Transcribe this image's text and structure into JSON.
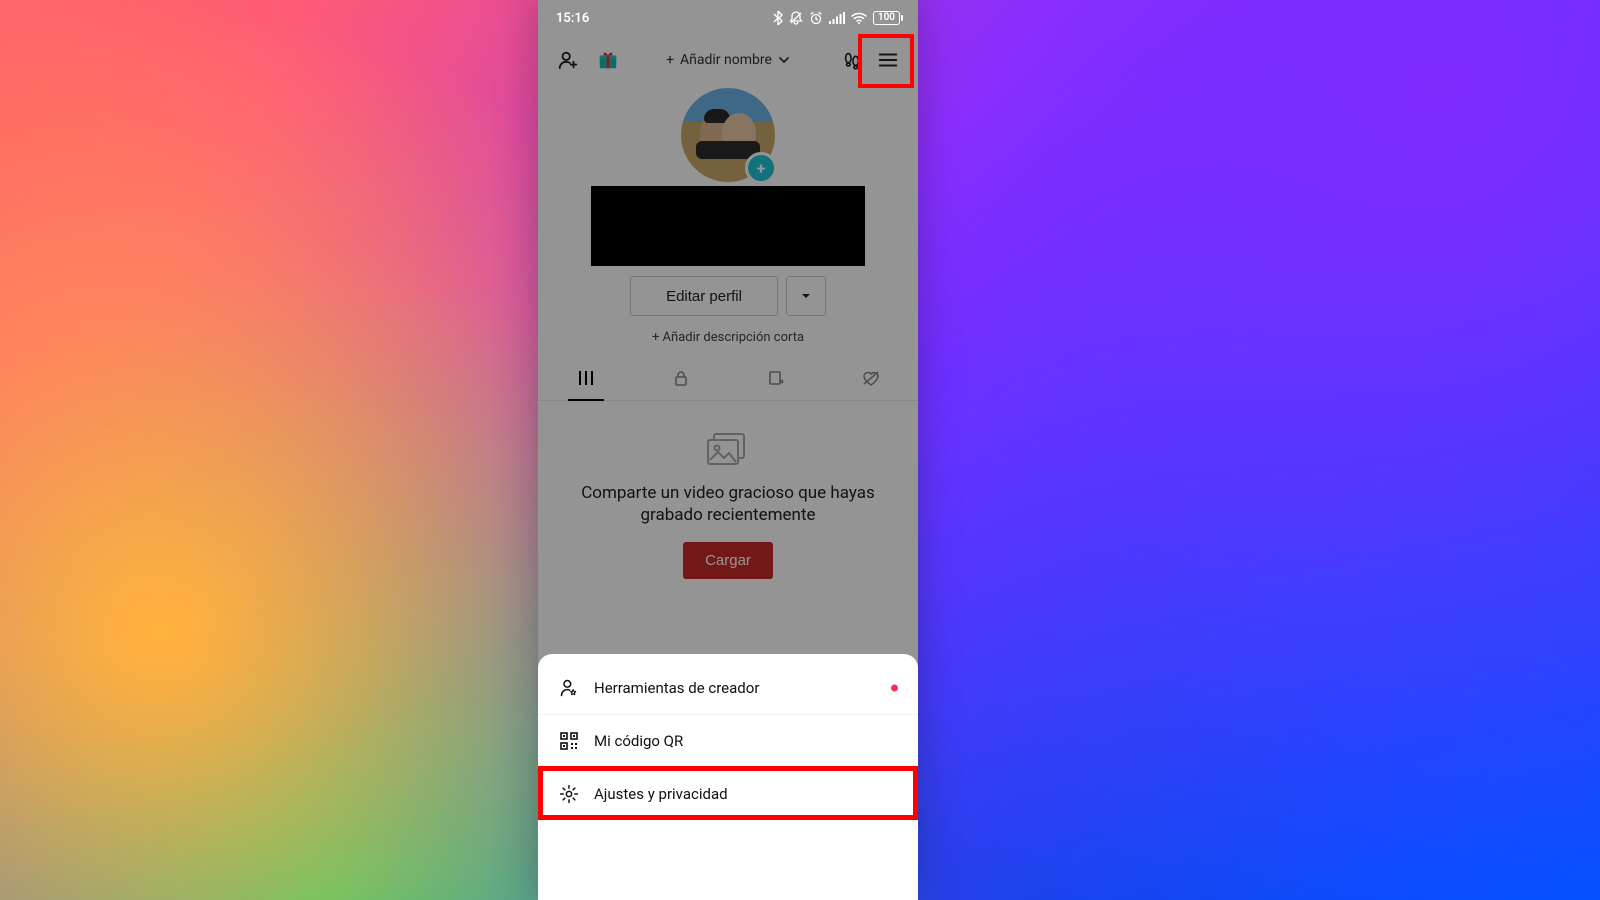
{
  "status": {
    "time": "15:16",
    "battery": "100"
  },
  "header": {
    "add_name_label": "Añadir nombre"
  },
  "profile": {
    "edit_button": "Editar perfil",
    "add_description": "+ Añadir descripción corta"
  },
  "empty_state": {
    "message": "Comparte un video gracioso que hayas grabado recientemente",
    "upload_button": "Cargar"
  },
  "sheet": {
    "items": [
      {
        "label": "Herramientas de creador",
        "has_dot": true
      },
      {
        "label": "Mi código QR"
      },
      {
        "label": "Ajustes y privacidad"
      }
    ]
  }
}
